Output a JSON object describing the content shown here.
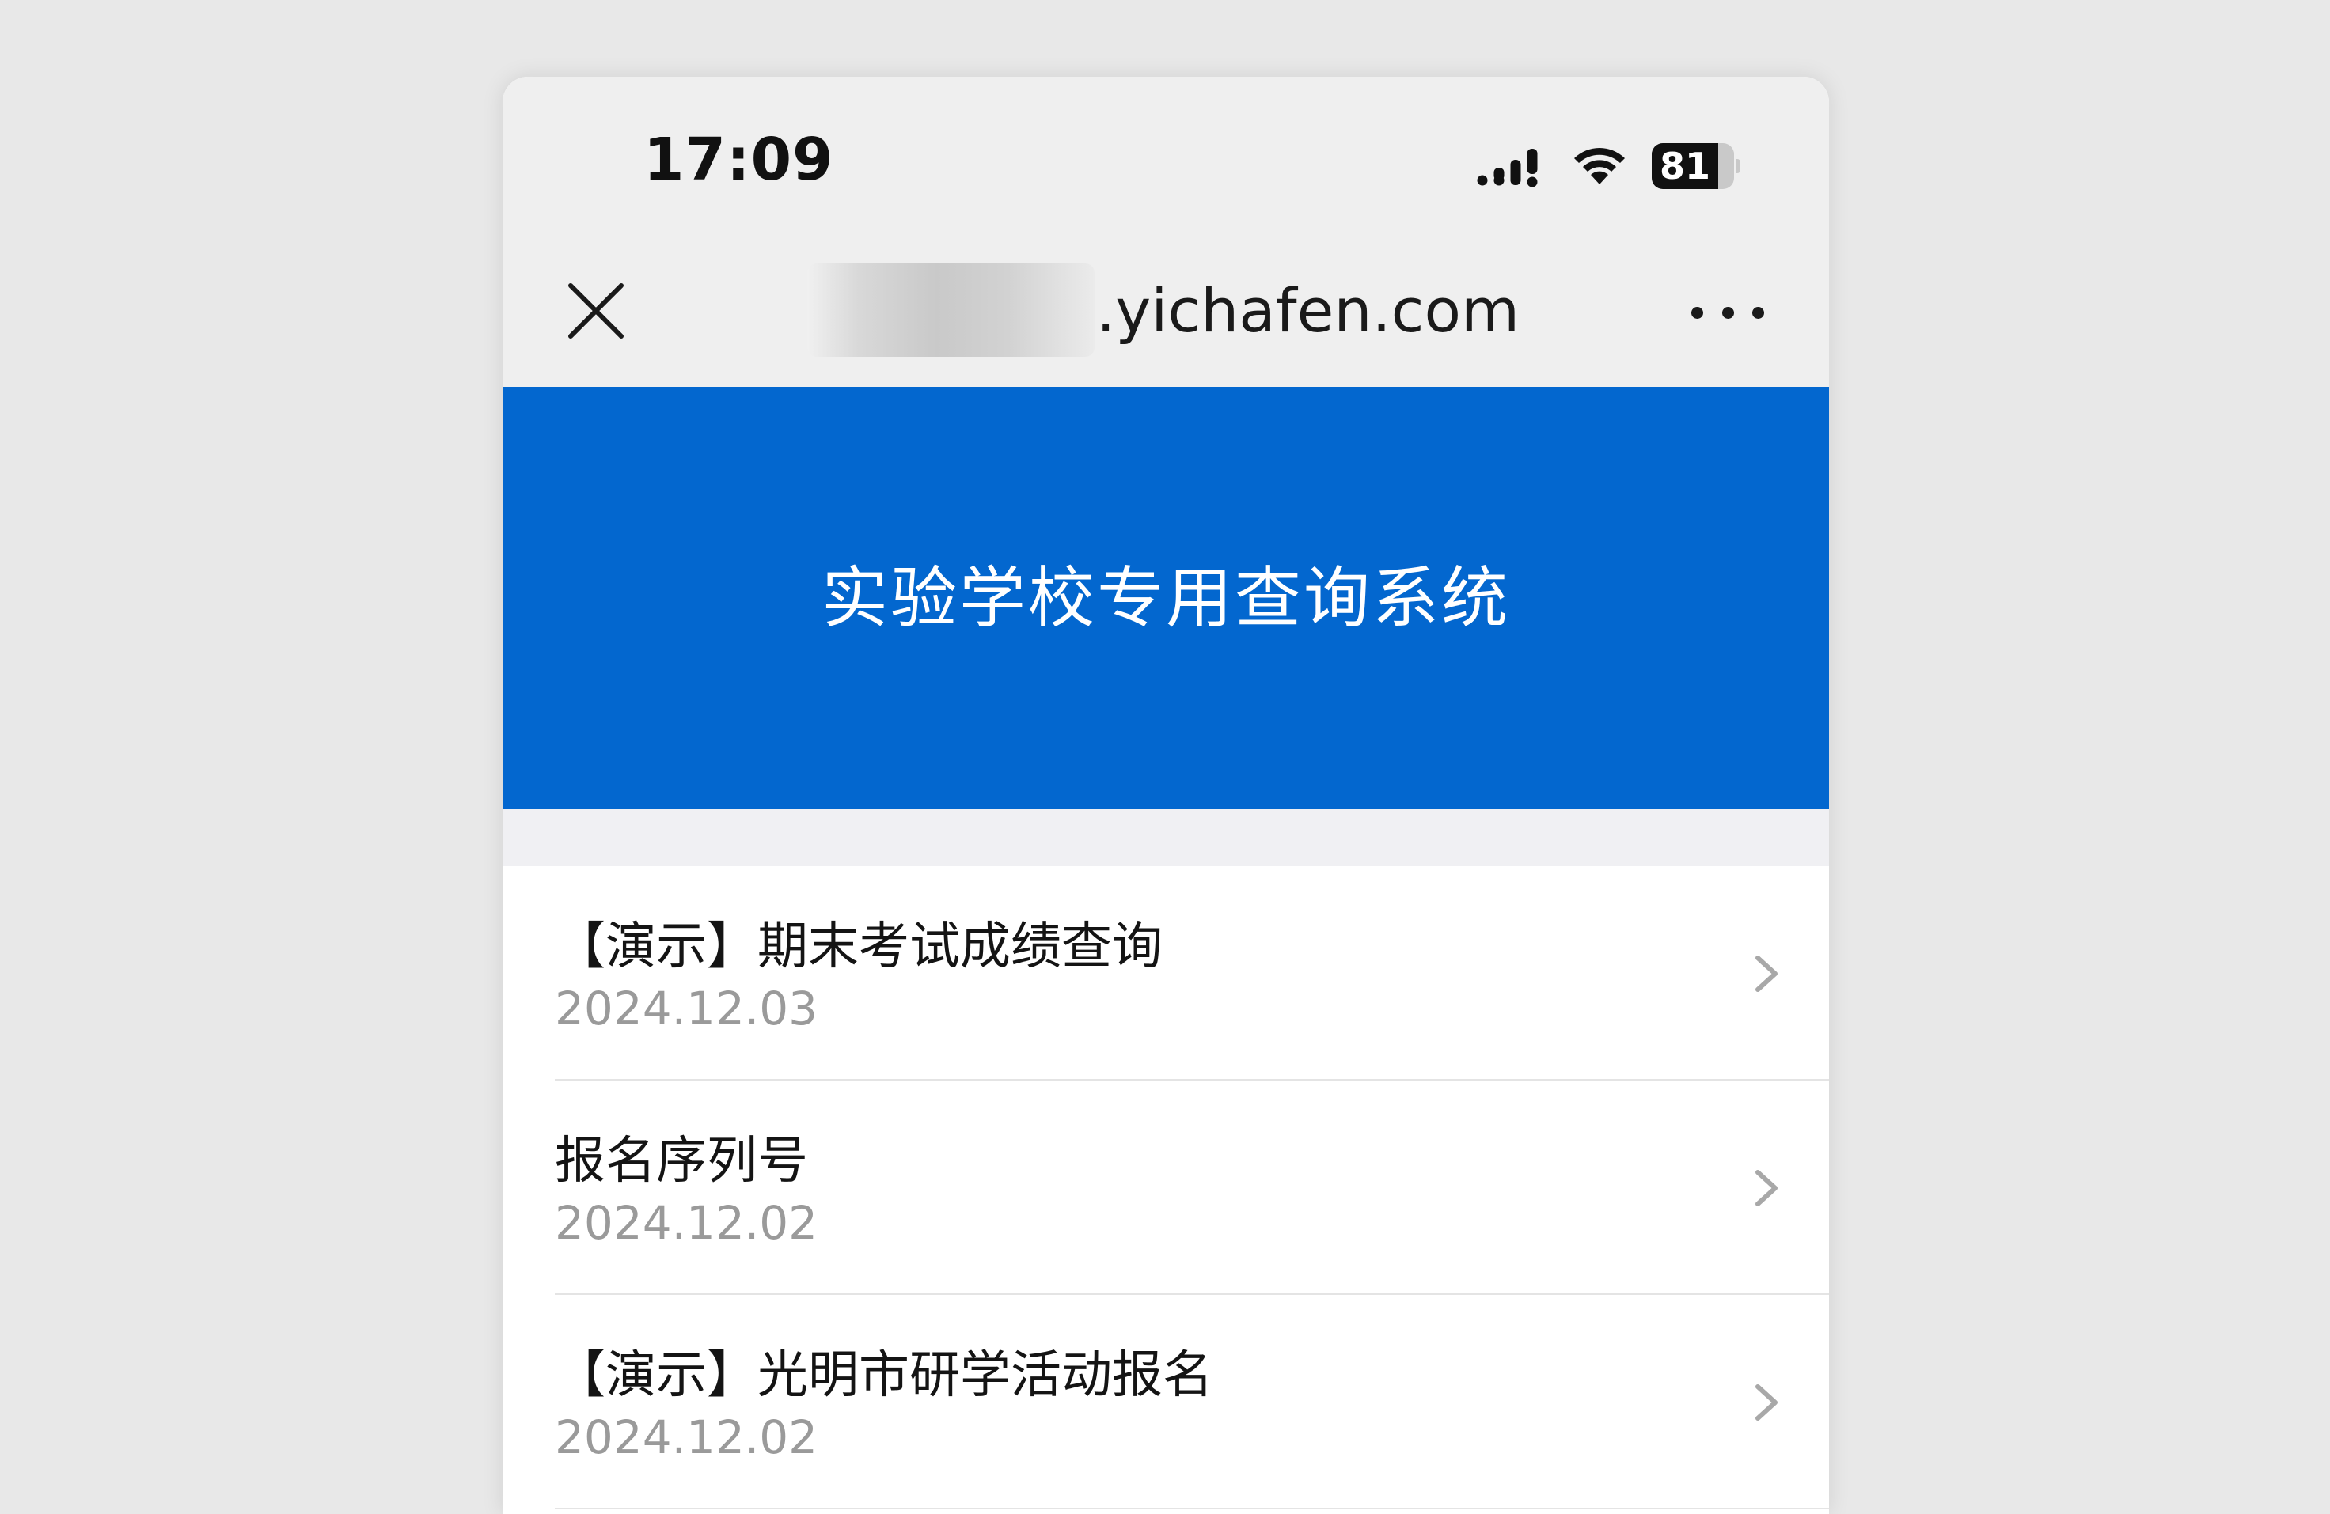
{
  "status_bar": {
    "time": "17:09",
    "battery_level": "81",
    "battery_fraction": 0.81,
    "icons": [
      "signal-icon",
      "wifi-icon",
      "battery-icon"
    ]
  },
  "nav_bar": {
    "domain": ".yichafen.com",
    "subdomain_blurred": true,
    "close_icon": "close-icon",
    "more_icon": "more-icon"
  },
  "header": {
    "title": "实验学校专用查询系统",
    "background_color": "#0367cf"
  },
  "list": {
    "items": [
      {
        "title": "【演示】期末考试成绩查询",
        "date": "2024.12.03"
      },
      {
        "title": "报名序列号",
        "date": "2024.12.02"
      },
      {
        "title": "【演示】光明市研学活动报名",
        "date": "2024.12.02"
      }
    ],
    "chevron_icon": "chevron-right-icon"
  }
}
